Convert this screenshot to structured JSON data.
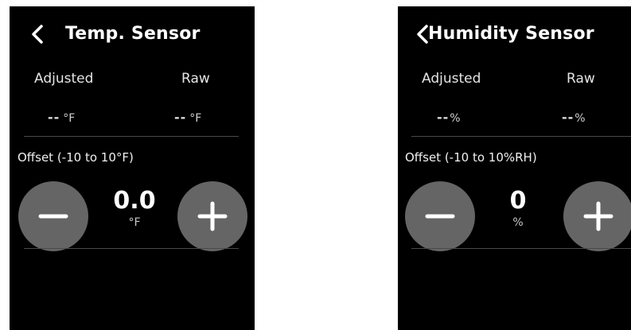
{
  "screens": [
    {
      "title": "Temp. Sensor",
      "adjusted_label": "Adjusted",
      "raw_label": "Raw",
      "adjusted_value": "--",
      "adjusted_unit": "°F",
      "raw_value": "--",
      "raw_unit": "°F",
      "offset_label": "Offset (-10 to 10°F)",
      "offset_value": "0.0",
      "offset_unit": "°F"
    },
    {
      "title": "Humidity Sensor",
      "adjusted_label": "Adjusted",
      "raw_label": "Raw",
      "adjusted_value": "--",
      "adjusted_unit": "%",
      "raw_value": "--",
      "raw_unit": "%",
      "offset_label": "Offset (-10 to 10%RH)",
      "offset_value": "0",
      "offset_unit": "%"
    }
  ],
  "icons": {
    "back": "chevron-left-icon",
    "decrease": "minus-icon",
    "increase": "plus-icon"
  },
  "colors": {
    "screen_background": "#000000",
    "button_fill": "#656565",
    "text": "#ffffff",
    "divider": "#4a4a4a"
  }
}
